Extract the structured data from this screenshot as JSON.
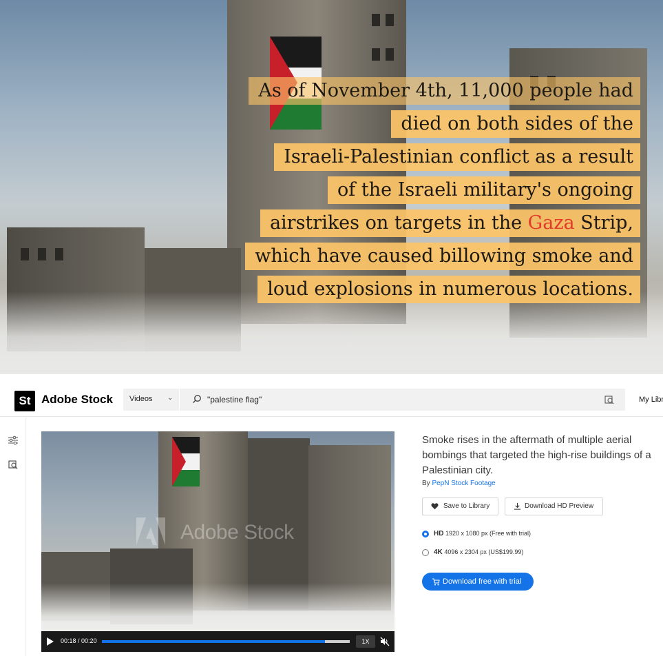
{
  "caption": {
    "lines": [
      "As of November 4th, 11,000 people had",
      "died on both sides of the",
      "Israeli-Palestinian conflict as a result",
      "of the Israeli military's ongoing",
      "airstrikes on targets in the ",
      "which have caused billowing smoke and",
      "loud explosions in numerous locations."
    ],
    "highlight_word": "Gaza",
    "highlight_suffix": " Strip,",
    "highlight_color": "#e23b2b",
    "box_color": "#fcc467"
  },
  "app": {
    "logo": "St",
    "brand": "Adobe Stock",
    "filter": "Videos",
    "search_value": "\"palestine flag\"",
    "my_library": "My Libr"
  },
  "asset": {
    "description": "Smoke rises in the aftermath of multiple aerial bombings that targeted the high-rise buildings of a Palestinian city.",
    "by_prefix": "By ",
    "author": "PepN Stock Footage",
    "save_label": "Save to Library",
    "preview_label": "Download HD Preview",
    "options": [
      {
        "name": "HD",
        "size": "1920 x 1080 px",
        "note": "(Free with trial)",
        "selected": true
      },
      {
        "name": "4K",
        "size": "4096 x 2304 px",
        "note": "(US$199.99)",
        "selected": false
      }
    ],
    "cta_label": "Download free with trial",
    "accent": "#1473e6"
  },
  "player": {
    "time_current": "00:18",
    "time_sep": " / ",
    "time_total": "00:20",
    "progress": 0.9,
    "speed": "1X",
    "watermark": "Adobe Stock"
  }
}
